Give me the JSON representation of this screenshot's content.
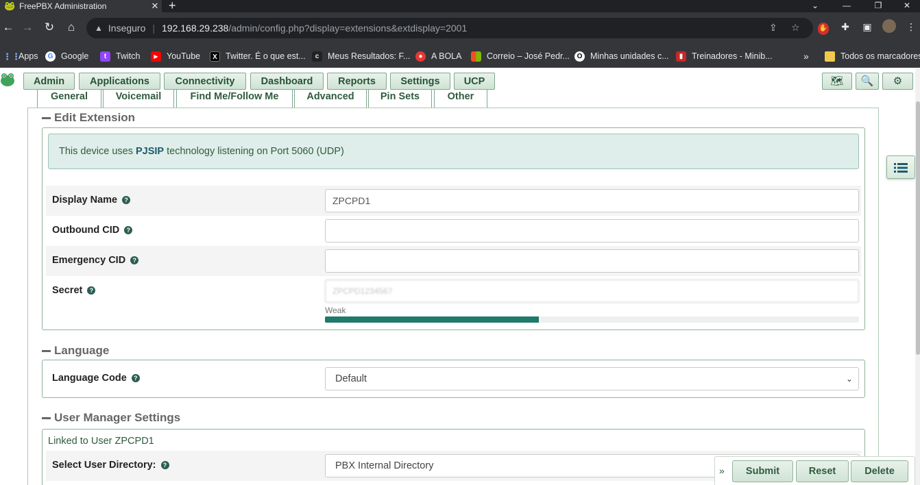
{
  "browser": {
    "tab_title": "FreePBX Administration",
    "tab_close": "✕",
    "new_tab": "+",
    "security_label": "Inseguro",
    "url_host": "192.168.29.238",
    "url_path": "/admin/config.php?display=extensions&extdisplay=2001",
    "window_controls": [
      "⌄",
      "—",
      "❐",
      "✕"
    ]
  },
  "bookmarks": {
    "items": [
      {
        "label": "Apps",
        "icon": "apps-grid-icon"
      },
      {
        "label": "Google",
        "icon": "google-icon"
      },
      {
        "label": "Twitch",
        "icon": "twitch-icon"
      },
      {
        "label": "YouTube",
        "icon": "youtube-icon"
      },
      {
        "label": "Twitter. É o que est...",
        "icon": "x-icon"
      },
      {
        "label": "Meus Resultados: F...",
        "icon": "bookmark-icon"
      },
      {
        "label": "A BOLA",
        "icon": "abola-icon"
      },
      {
        "label": "Correio – José Pedr...",
        "icon": "microsoft-icon"
      },
      {
        "label": "Minhas unidades c...",
        "icon": "circle-icon"
      },
      {
        "label": "Treinadores - Minib...",
        "icon": "bookmark-icon"
      }
    ],
    "overflow": "»",
    "all_label": "Todos os marcadores"
  },
  "pbx_nav": {
    "items": [
      "Admin",
      "Applications",
      "Connectivity",
      "Dashboard",
      "Reports",
      "Settings",
      "UCP"
    ]
  },
  "tabs": [
    "General",
    "Voicemail",
    "Find Me/Follow Me",
    "Advanced",
    "Pin Sets",
    "Other"
  ],
  "sections": {
    "edit_extension": "Edit Extension",
    "language": "Language",
    "user_manager": "User Manager Settings"
  },
  "info": {
    "prefix": "This device uses",
    "tech": "PJSIP",
    "suffix": "technology listening on Port 5060 (UDP)"
  },
  "fields": {
    "display_name": {
      "label": "Display Name",
      "value": "ZPCPD1"
    },
    "outbound_cid": {
      "label": "Outbound CID",
      "value": ""
    },
    "emergency_cid": {
      "label": "Emergency CID",
      "value": ""
    },
    "secret": {
      "label": "Secret",
      "value": "ZPCPD1234567"
    },
    "strength_label": "Weak",
    "strength_fraction": 0.4,
    "language_code": {
      "label": "Language Code",
      "value": "Default"
    },
    "linked_user": "Linked to User ZPCPD1",
    "user_directory": {
      "label": "Select User Directory:",
      "value": "PBX Internal Directory"
    }
  },
  "actions": {
    "chevron": "»",
    "submit": "Submit",
    "reset": "Reset",
    "delete": "Delete"
  },
  "colors": {
    "accent": "#2f5b3e",
    "bar_fill": "#1f7a6b",
    "info_bg": "#dfeeea"
  }
}
